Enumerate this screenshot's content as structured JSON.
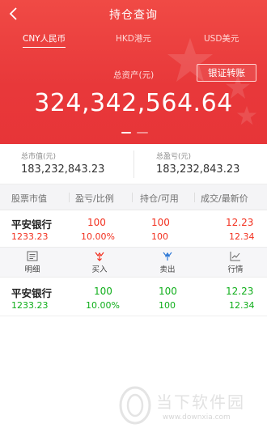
{
  "nav": {
    "title": "持仓查询"
  },
  "tabs": [
    {
      "label": "CNY人民币",
      "active": true
    },
    {
      "label": "HKD港元",
      "active": false
    },
    {
      "label": "USD美元",
      "active": false
    }
  ],
  "assets": {
    "total_label": "总资产(元)",
    "transfer_button": "银证转账",
    "total_value": "324,342,564.64"
  },
  "summary": {
    "market_value_label": "总市值(元)",
    "market_value": "183,232,843.23",
    "profit_label": "总盈亏(元)",
    "profit": "183,232,843.23"
  },
  "table": {
    "headers": [
      "股票市值",
      "盈亏/比例",
      "持仓/可用",
      "成交/最新价"
    ],
    "rows": [
      {
        "name": "平安银行",
        "market_value": "1233.23",
        "pl": "100",
        "pl_ratio": "10.00%",
        "position": "100",
        "available": "100",
        "deal_price": "12.23",
        "latest_price": "12.34",
        "color": "#f2301f"
      },
      {
        "name": "平安银行",
        "market_value": "1233.23",
        "pl": "100",
        "pl_ratio": "10.00%",
        "position": "100",
        "available": "100",
        "deal_price": "12.23",
        "latest_price": "12.34",
        "color": "#0fae1a"
      }
    ]
  },
  "actions": [
    {
      "label": "明细",
      "icon": "list-detail-icon"
    },
    {
      "label": "买入",
      "icon": "buy-icon"
    },
    {
      "label": "卖出",
      "icon": "sell-icon"
    },
    {
      "label": "行情",
      "icon": "market-chart-icon"
    }
  ],
  "watermark": {
    "title": "当下软件园",
    "url": "www.downxia.com"
  },
  "colors": {
    "header_red": "#e8383a",
    "gain_red": "#f2301f",
    "gain_green": "#0fae1a"
  }
}
